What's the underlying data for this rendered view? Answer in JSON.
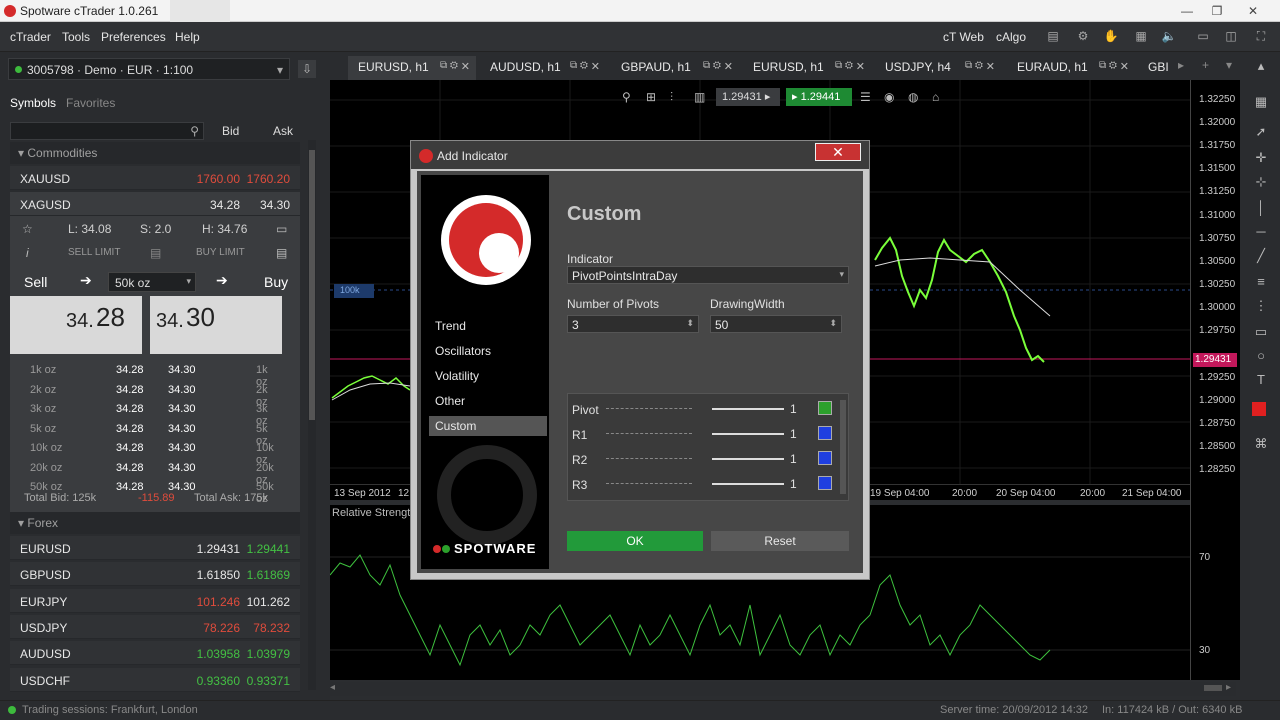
{
  "window": {
    "title": "Spotware cTrader 1.0.261",
    "min": "—",
    "max": "❐",
    "close": "✕"
  },
  "menu": {
    "items": [
      "cTrader",
      "Tools",
      "Preferences",
      "Help"
    ],
    "right": [
      "cT Web",
      "cAlgo"
    ]
  },
  "account": {
    "label": "3005798 · Demo · EUR · 1:100"
  },
  "symbols": {
    "tab_symbols": "Symbols",
    "tab_favorites": "Favorites",
    "col_bid": "Bid",
    "col_ask": "Ask"
  },
  "commodities": {
    "title": "Commodities",
    "rows": [
      {
        "symbol": "XAUUSD",
        "bid": "1760.00",
        "ask": "1760.20"
      },
      {
        "symbol": "XAGUSD",
        "bid": "34.28",
        "ask": "34.30"
      }
    ],
    "stats": {
      "low": "L: 34.08",
      "spread": "S: 2.0",
      "high": "H: 34.76"
    },
    "sell_limit": "SELL LIMIT",
    "buy_limit": "BUY LIMIT",
    "sell": "Sell",
    "buy": "Buy",
    "qty": "50k oz",
    "sell_price_a": "34.",
    "sell_price_b": "28",
    "buy_price_a": "34.",
    "buy_price_b": "30",
    "ladder": [
      [
        "1k oz",
        "34.28",
        "34.30",
        "1k oz"
      ],
      [
        "2k oz",
        "34.28",
        "34.30",
        "2k oz"
      ],
      [
        "3k oz",
        "34.28",
        "34.30",
        "3k oz"
      ],
      [
        "5k oz",
        "34.28",
        "34.30",
        "5k oz"
      ],
      [
        "10k oz",
        "34.28",
        "34.30",
        "10k oz"
      ],
      [
        "20k oz",
        "34.28",
        "34.30",
        "20k oz"
      ],
      [
        "50k oz",
        "34.28",
        "34.30",
        "50k oz"
      ]
    ],
    "total_bid": "Total Bid: 125k",
    "net": "-115.89",
    "total_ask": "Total Ask: 175k"
  },
  "forex": {
    "title": "Forex",
    "rows": [
      {
        "symbol": "EURUSD",
        "bid": "1.29431",
        "ask": "1.29441",
        "bc": "wht",
        "ac": "grn"
      },
      {
        "symbol": "GBPUSD",
        "bid": "1.61850",
        "ask": "1.61869",
        "bc": "wht",
        "ac": "grn"
      },
      {
        "symbol": "EURJPY",
        "bid": "101.246",
        "ask": "101.262",
        "bc": "red",
        "ac": "wht"
      },
      {
        "symbol": "USDJPY",
        "bid": "78.226",
        "ask": "78.232",
        "bc": "red",
        "ac": "red"
      },
      {
        "symbol": "AUDUSD",
        "bid": "1.03958",
        "ask": "1.03979",
        "bc": "grn",
        "ac": "grn"
      },
      {
        "symbol": "USDCHF",
        "bid": "0.93360",
        "ask": "0.93371",
        "bc": "grn",
        "ac": "grn"
      }
    ]
  },
  "status": {
    "sessions": "Trading sessions:  Frankfurt, London",
    "server": "Server time: 20/09/2012 14:32",
    "traffic": "In: 117424 kB / Out: 6340 kB"
  },
  "chart_tabs": [
    "EURUSD, h1",
    "AUDUSD, h1",
    "GBPAUD, h1",
    "EURUSD, h1",
    "USDJPY, h4",
    "EURAUD, h1",
    "GBI"
  ],
  "chart": {
    "bid": "1.29431",
    "ask": "1.29441",
    "qty_badge": "100k",
    "prices": [
      "1.32250",
      "1.32000",
      "1.31750",
      "1.31500",
      "1.31250",
      "1.31000",
      "1.30750",
      "1.30500",
      "1.30250",
      "1.30000",
      "1.29750",
      "1.29431",
      "1.29250",
      "1.29000",
      "1.28750",
      "1.28500",
      "1.28250"
    ],
    "times": [
      "13 Sep 2012",
      "12",
      "19 Sep 04:00",
      "20:00",
      "20 Sep 04:00",
      "20:00",
      "21 Sep 04:00"
    ],
    "indicator": "Relative Strength",
    "rsi_levels": [
      "70",
      "30"
    ]
  },
  "dialog": {
    "title": "Add Indicator",
    "close": "✕",
    "categories": [
      "Trend",
      "Oscillators",
      "Volatility",
      "Other",
      "Custom"
    ],
    "brand": "SPOTWARE",
    "heading": "Custom",
    "indicator_label": "Indicator",
    "indicator_value": "PivotPointsIntraDay",
    "pivots_label": "Number of Pivots",
    "pivots_value": "3",
    "width_label": "DrawingWidth",
    "width_value": "50",
    "lines": [
      {
        "name": "Pivot",
        "width": "1",
        "color": "#2ca02c"
      },
      {
        "name": "R1",
        "width": "1",
        "color": "#1f3fe0"
      },
      {
        "name": "R2",
        "width": "1",
        "color": "#1f3fe0"
      },
      {
        "name": "R3",
        "width": "1",
        "color": "#1f3fe0"
      }
    ],
    "ok": "OK",
    "reset": "Reset"
  }
}
